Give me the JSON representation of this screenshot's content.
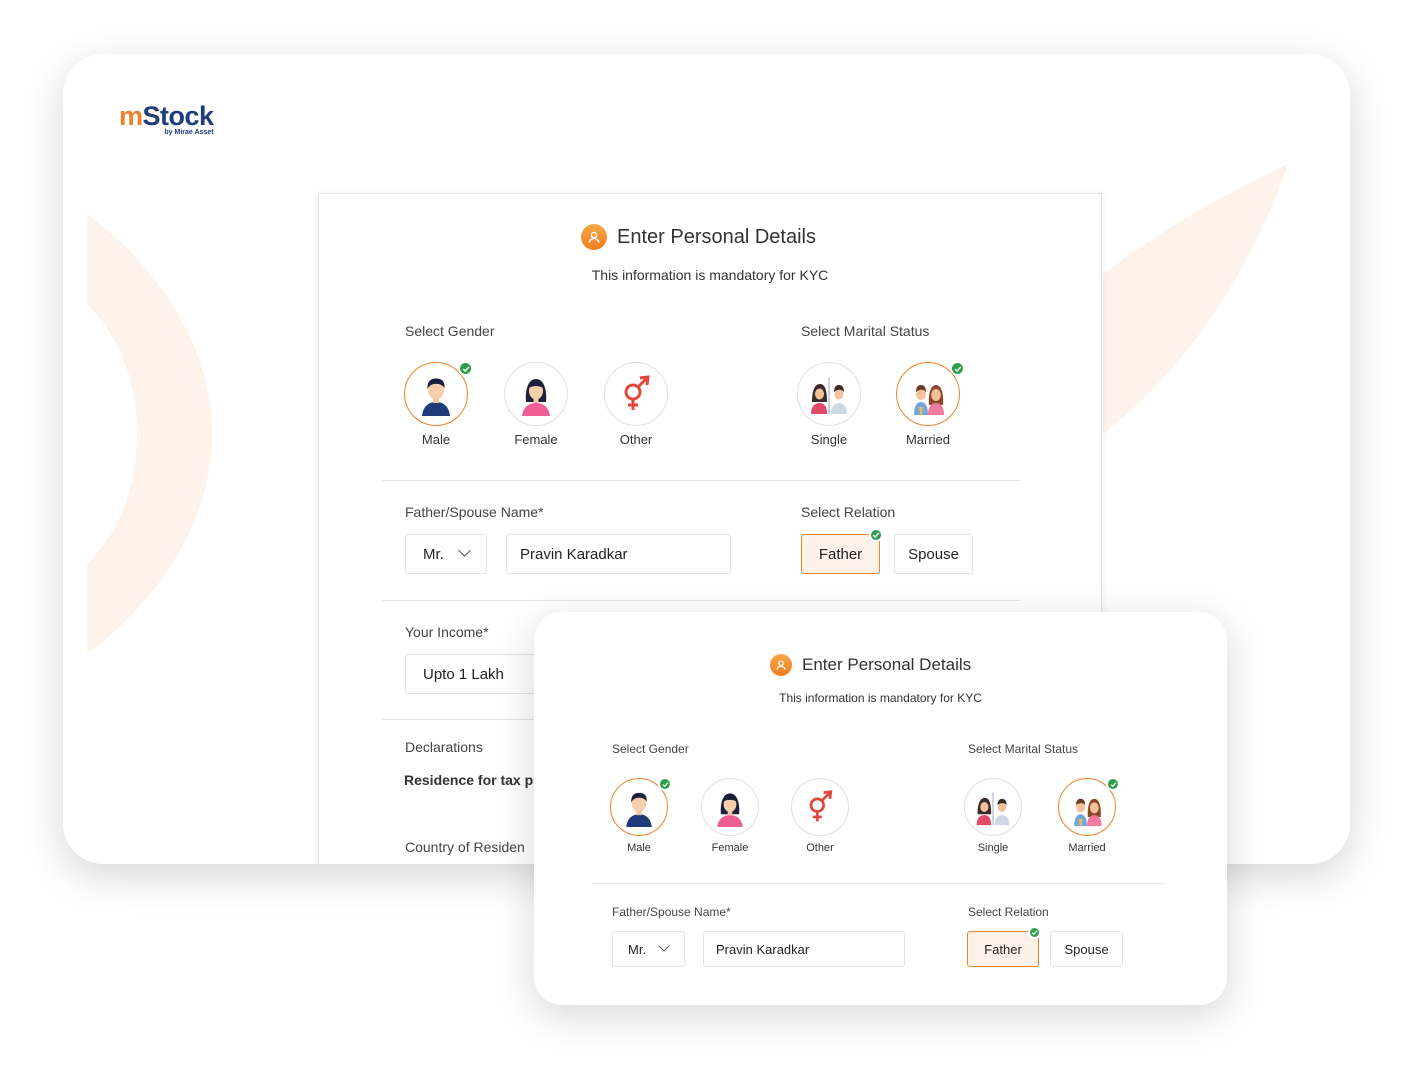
{
  "brand": {
    "logo_m": "m",
    "logo_stock": "Stock",
    "logo_sub": "by Mirae Asset",
    "accent": "#f0822a",
    "navy": "#1f3d7a",
    "check_green": "#2e9e4f"
  },
  "desktop_form": {
    "title": "Enter Personal Details",
    "subtitle": "This information is mandatory for KYC",
    "gender_label": "Select Gender",
    "genders": [
      {
        "label": "Male",
        "icon": "male-avatar-icon",
        "selected": true
      },
      {
        "label": "Female",
        "icon": "female-avatar-icon",
        "selected": false
      },
      {
        "label": "Other",
        "icon": "gender-symbol-icon",
        "selected": false
      }
    ],
    "marital_label": "Select Marital Status",
    "marital": [
      {
        "label": "Single",
        "icon": "single-couple-icon",
        "selected": false
      },
      {
        "label": "Married",
        "icon": "married-couple-icon",
        "selected": true
      }
    ],
    "name_label": "Father/Spouse Name*",
    "salutation": "Mr.",
    "name_value": "Pravin Karadkar",
    "relation_label": "Select Relation",
    "relations": [
      {
        "label": "Father",
        "selected": true
      },
      {
        "label": "Spouse",
        "selected": false
      }
    ],
    "income_label": "Your Income*",
    "income_value": "Upto 1 Lakh",
    "declarations_label": "Declarations",
    "residence_label": "Residence for tax p",
    "country_label": "Country of Residen"
  },
  "mobile_form": {
    "title": "Enter Personal Details",
    "subtitle": "This information is mandatory for KYC",
    "gender_label": "Select Gender",
    "genders": [
      {
        "label": "Male",
        "selected": true
      },
      {
        "label": "Female",
        "selected": false
      },
      {
        "label": "Other",
        "selected": false
      }
    ],
    "marital_label": "Select Marital Status",
    "marital": [
      {
        "label": "Single",
        "selected": false
      },
      {
        "label": "Married",
        "selected": true
      }
    ],
    "name_label": "Father/Spouse Name*",
    "salutation": "Mr.",
    "name_value": "Pravin Karadkar",
    "relation_label": "Select Relation",
    "relations": [
      {
        "label": "Father",
        "selected": true
      },
      {
        "label": "Spouse",
        "selected": false
      }
    ]
  }
}
